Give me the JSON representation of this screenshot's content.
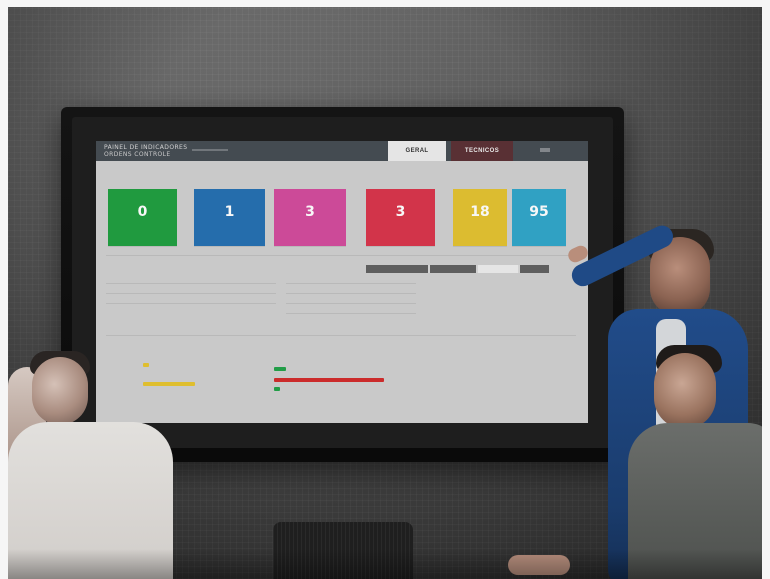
{
  "dashboard": {
    "title_line1": "PAINEL DE INDICADORES",
    "title_line2": "ORDENS CONTROLE",
    "tabs": [
      {
        "label": "GERAL"
      },
      {
        "label": "TECNICOS"
      }
    ],
    "tiles": [
      {
        "value": "0",
        "color": "#1f9e3f"
      },
      {
        "value": "1",
        "color": "#246fb0"
      },
      {
        "value": "3",
        "color": "#d24a9c"
      },
      {
        "value": "3",
        "color": "#d8334a"
      },
      {
        "value": "18",
        "color": "#e2c12f"
      },
      {
        "value": "95",
        "color": "#2fa5c8"
      }
    ]
  }
}
